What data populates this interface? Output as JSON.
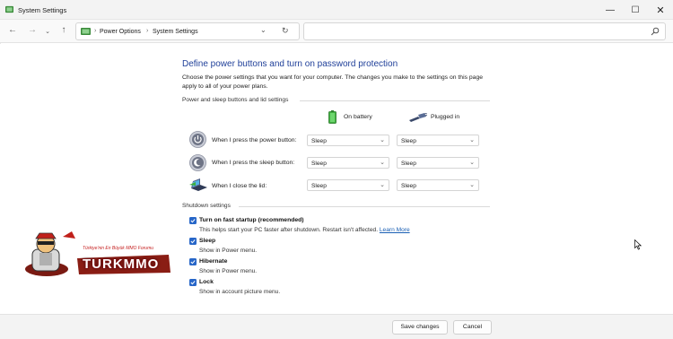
{
  "window": {
    "title": "System Settings",
    "controls": {
      "minimize": "—",
      "maximize": "☐",
      "close": "✕"
    }
  },
  "addressbar": {
    "back": "←",
    "forward": "→",
    "recent": "⌄",
    "up": "↑",
    "separator": "›",
    "breadcrumbs": [
      "Power Options",
      "System Settings"
    ],
    "dropdown": "⌄",
    "refresh": "↻"
  },
  "page": {
    "heading": "Define power buttons and turn on password protection",
    "description": "Choose the power settings that you want for your computer. The changes you make to the settings on this page apply to all of your power plans."
  },
  "power_section": {
    "title": "Power and sleep buttons and lid settings",
    "columns": {
      "battery": "On battery",
      "plugged": "Plugged in"
    },
    "rows": [
      {
        "label": "When I press the power button:",
        "battery": "Sleep",
        "plugged": "Sleep",
        "icon": "power-button-icon"
      },
      {
        "label": "When I press the sleep button:",
        "battery": "Sleep",
        "plugged": "Sleep",
        "icon": "sleep-button-icon"
      },
      {
        "label": "When I close the lid:",
        "battery": "Sleep",
        "plugged": "Sleep",
        "icon": "laptop-lid-icon"
      }
    ],
    "chevron": "⌄"
  },
  "shutdown_section": {
    "title": "Shutdown settings",
    "items": [
      {
        "label": "Turn on fast startup (recommended)",
        "description": "This helps start your PC faster after shutdown. Restart isn't affected.",
        "link": "Learn More",
        "checked": true
      },
      {
        "label": "Sleep",
        "description": "Show in Power menu.",
        "checked": true
      },
      {
        "label": "Hibernate",
        "description": "Show in Power menu.",
        "checked": true
      },
      {
        "label": "Lock",
        "description": "Show in account picture menu.",
        "checked": true
      }
    ]
  },
  "footer": {
    "save": "Save changes",
    "cancel": "Cancel"
  },
  "watermark": {
    "tagline": "Türkiye'nin En Büyük MMO Forumu",
    "brand": "TURKMMO"
  },
  "colors": {
    "accent": "#2766c8",
    "heading": "#1f3f99",
    "link": "#1a5fb4"
  }
}
